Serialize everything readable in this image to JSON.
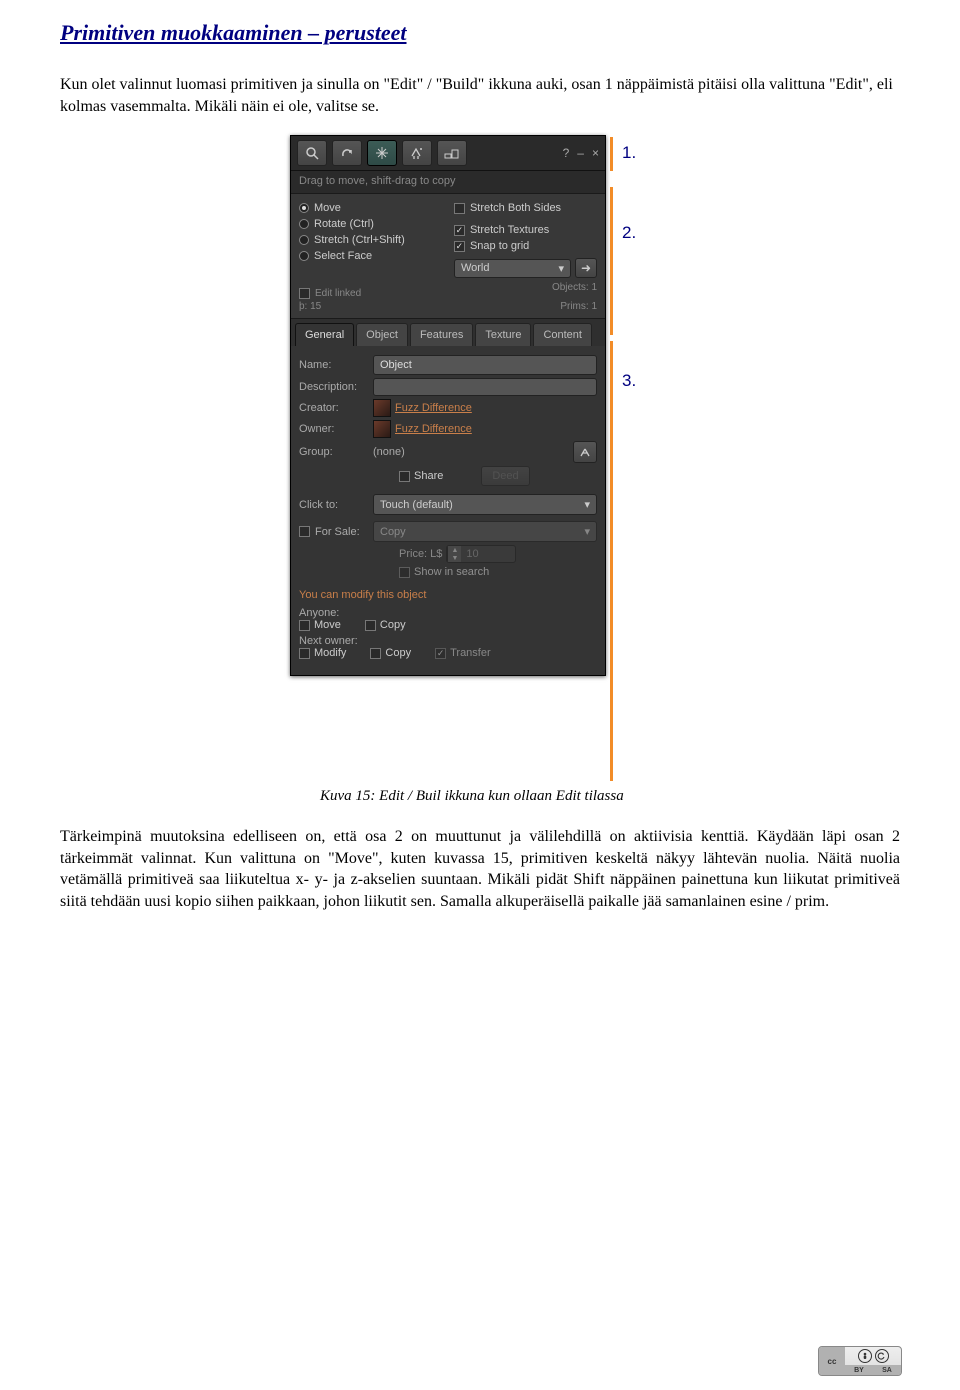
{
  "doc": {
    "title": "Primitiven muokkaaminen – perusteet",
    "intro": "Kun olet valinnut luomasi primitiven ja sinulla on \"Edit\" / \"Build\" ikkuna auki, osan 1 näppäimistä pitäisi olla valittuna \"Edit\", eli kolmas vasemmalta. Mikäli näin ei ole, valitse se.",
    "caption": "Kuva 15: Edit / Buil ikkuna kun ollaan Edit tilassa",
    "body": "Tärkeimpinä muutoksina edelliseen on, että osa 2 on muuttunut ja välilehdillä on aktiivisia kenttiä. Käydään läpi osan 2 tärkeimmät valinnat. Kun valittuna on \"Move\", kuten kuvassa 15, primitiven keskeltä näkyy lähtevän nuolia. Näitä nuolia vetämällä primitiveä saa liikuteltua x- y- ja z-akselien suuntaan. Mikäli pidät Shift näppäinen painettuna kun liikutat primitiveä siitä tehdään uusi kopio siihen paikkaan, johon liikutit sen. Samalla alkuperäisellä paikalle jää samanlainen esine / prim."
  },
  "markers": {
    "m1": "1.",
    "m2": "2.",
    "m3": "3."
  },
  "panel": {
    "hint": "Drag to move, shift-drag to copy",
    "radios": {
      "move": "Move",
      "rotate": "Rotate (Ctrl)",
      "stretch": "Stretch (Ctrl+Shift)",
      "select_face": "Select Face"
    },
    "checks": {
      "stretch_both": "Stretch Both Sides",
      "stretch_tex": "Stretch Textures",
      "snap": "Snap to grid"
    },
    "world": "World",
    "edit_linked": "Edit linked",
    "stats": {
      "p_label": "þ:",
      "p_val": "15",
      "objects_label": "Objects:",
      "objects_val": "1",
      "prims_label": "Prims:",
      "prims_val": "1"
    },
    "tabs": {
      "general": "General",
      "object": "Object",
      "features": "Features",
      "texture": "Texture",
      "content": "Content"
    },
    "fields": {
      "name_label": "Name:",
      "name_value": "Object",
      "desc_label": "Description:",
      "desc_value": "",
      "creator_label": "Creator:",
      "creator_value": "Fuzz Difference",
      "owner_label": "Owner:",
      "owner_value": "Fuzz Difference",
      "group_label": "Group:",
      "group_value": "(none)",
      "share": "Share",
      "deed": "Deed",
      "clickto_label": "Click to:",
      "clickto_value": "Touch (default)",
      "for_sale": "For Sale:",
      "for_sale_sel": "Copy",
      "price_label": "Price: L$",
      "price_value": "10",
      "show_in_search": "Show in search"
    },
    "perms": {
      "modify_msg": "You can modify this object",
      "anyone": "Anyone:",
      "move": "Move",
      "copy": "Copy",
      "next_owner": "Next owner:",
      "modify": "Modify",
      "transfer": "Transfer"
    }
  },
  "cc": {
    "label": "cc",
    "by": "BY",
    "sa": "SA"
  }
}
